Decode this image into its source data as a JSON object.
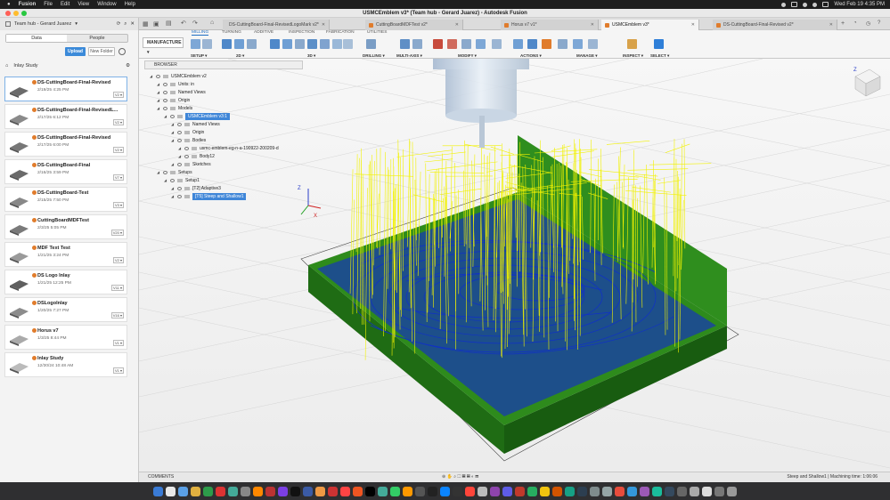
{
  "menubar": {
    "apple": "",
    "items": [
      "Fusion",
      "File",
      "Edit",
      "View",
      "Window",
      "Help"
    ],
    "clock": "Wed Feb 19  4:35 PM"
  },
  "window": {
    "title": "USMCEmblem v3* (Team hub - Gerard Juarez) - Autodesk Fusion"
  },
  "hub": {
    "label": "Team hub - Gerard Juarez"
  },
  "doc_tabs": [
    {
      "label": "DS-CuttingBoard-Final-RevisedLogoMark v2*"
    },
    {
      "label": "CuttingBoardMDFTest v2*"
    },
    {
      "label": "Horus v7 v1*"
    },
    {
      "label": "USMCEmblem v3*"
    },
    {
      "label": "DS-CuttingBoard-Final-Revised v2*"
    }
  ],
  "data_panel": {
    "seg_data": "Data",
    "seg_people": "People",
    "upload": "Upload",
    "new_folder": "New Folder",
    "crumb": "Inlay Study",
    "files": [
      {
        "name": "DS-CuttingBoard-Final-Revised",
        "date": "2/19/25 4:25 PM",
        "ver": "V2 ▾"
      },
      {
        "name": "DS-CuttingBoard-Final-RevisedL...",
        "date": "2/17/25 6:12 PM",
        "ver": "V2 ▾"
      },
      {
        "name": "DS-CuttingBoard-Final-Revised",
        "date": "2/17/25 6:00 PM",
        "ver": "V2 ▾"
      },
      {
        "name": "DS-CuttingBoard-Final",
        "date": "2/16/25 3:59 PM",
        "ver": "V7 ▾"
      },
      {
        "name": "DS-CuttingBoard-Test",
        "date": "2/15/25 7:50 PM",
        "ver": "V3 ▾"
      },
      {
        "name": "CuttingBoardMDFTest",
        "date": "2/3/25 5:05 PM",
        "ver": "V20 ▾"
      },
      {
        "name": "MDF Text Test",
        "date": "1/21/25 3:24 PM",
        "ver": "V2 ▾"
      },
      {
        "name": "DS Logo Inlay",
        "date": "1/21/25 12:25 PM",
        "ver": "V11 ▾"
      },
      {
        "name": "DSLogoInlay",
        "date": "1/20/25 7:27 PM",
        "ver": "V16 ▾"
      },
      {
        "name": "Horus v7",
        "date": "1/3/25 8:44 PM",
        "ver": "V1 ▾"
      },
      {
        "name": "Inlay Study",
        "date": "12/30/24 10:48 AM",
        "ver": "V1 ▾"
      }
    ]
  },
  "toolbar": {
    "workspace": "MANUFACTURE ▾",
    "ribbon_tabs": [
      "MILLING",
      "TURNING",
      "ADDITIVE",
      "INSPECTION",
      "FABRICATION",
      "UTILITIES"
    ],
    "groups": [
      "SETUP ▾",
      "2D ▾",
      "3D ▾",
      "DRILLING ▾",
      "MULTI-AXIS ▾",
      "MODIFY ▾",
      "ACTIONS ▾",
      "MANAGE ▾",
      "INSPECT ▾",
      "SELECT ▾"
    ]
  },
  "browser": {
    "title": "BROWSER",
    "rows": [
      "USMCEmblem v2",
      "Units: in",
      "Named Views",
      "Origin",
      "Models",
      "USMCEmblem v3:1",
      "Named Views",
      "Origin",
      "Bodies",
      "usmc-emblem-eg-n-a-190922-200209-d",
      "Body12",
      "Sketches",
      "Setups",
      "Setup1",
      "[T2] Adaptive3",
      "[T5] Steep and Shallow1"
    ]
  },
  "status": {
    "comments": "COMMENTS",
    "right": "Steep and Shallow1 | Machining time: 1:06:06"
  },
  "colors": {
    "stock": "#2e8b1c",
    "toolpath_rapid": "#f2f200",
    "toolpath_cut": "#1030c8",
    "accent": "#3f86d8"
  }
}
